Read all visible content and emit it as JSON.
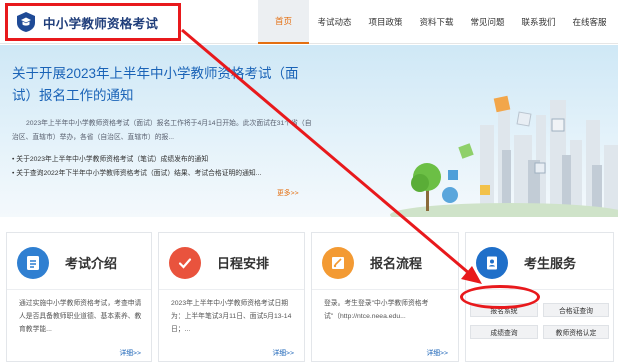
{
  "header": {
    "logo_text": "中小学教师资格考试",
    "nav": [
      {
        "label": "首页",
        "active": true
      },
      {
        "label": "考试动态",
        "active": false
      },
      {
        "label": "项目政策",
        "active": false
      },
      {
        "label": "资料下载",
        "active": false
      },
      {
        "label": "常见问题",
        "active": false
      },
      {
        "label": "联系我们",
        "active": false
      },
      {
        "label": "在线客服",
        "active": false
      }
    ]
  },
  "notice": {
    "title": "关于开展2023年上半年中小学教师资格考试（面试）报名工作的通知",
    "summary": "2023年上半年中小学教师资格考试（面试）报名工作将于4月14日开始。此次面试在31个省（自治区、直辖市）举办，各省（自治区、直辖市）的报...",
    "bullets": [
      "关于2023年上半年中小学教师资格考试（笔试）成绩发布的通知",
      "关于查询2022年下半年中小学教师资格考试（面试）结果、考试合格证明的通知..."
    ],
    "more": "更多>>"
  },
  "cards": {
    "exam_intro": {
      "title": "考试介绍",
      "body": "通过实施中小学教师资格考试，考查申请人是否具备教师职业道德、基本素养、教育教学能...",
      "more": "详细>>"
    },
    "schedule": {
      "title": "日程安排",
      "body": "2023年上半年中小学教师资格考试日期为：上半年笔试3月11日、面试5月13-14日；...",
      "more": "详细>>"
    },
    "process": {
      "title": "报名流程",
      "body": "登录。考生登录\"中小学教师资格考试\"（http://ntce.neea.edu...",
      "more": "详细>>"
    },
    "services": {
      "title": "考生服务",
      "buttons": [
        "报名系统",
        "合格证查询",
        "成绩查询",
        "教师资格认定"
      ]
    }
  },
  "colors": {
    "accent_orange": "#e46f11",
    "title_blue": "#1a63b7",
    "annotation_red": "#e8191c"
  }
}
